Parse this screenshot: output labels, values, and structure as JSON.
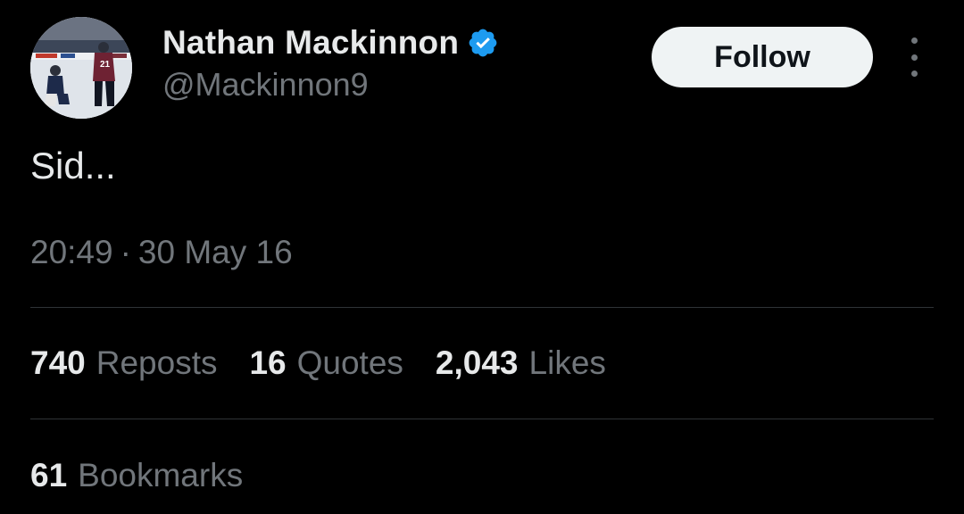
{
  "user": {
    "display_name": "Nathan Mackinnon",
    "handle": "@Mackinnon9",
    "verified": true,
    "avatar_icon": "hockey-players-avatar"
  },
  "actions": {
    "follow_label": "Follow",
    "more_icon": "more-vertical-icon"
  },
  "tweet": {
    "text": "Sid...",
    "time": "20:49",
    "separator": "·",
    "date": "30 May 16"
  },
  "stats": {
    "reposts": {
      "count": "740",
      "label": "Reposts"
    },
    "quotes": {
      "count": "16",
      "label": "Quotes"
    },
    "likes": {
      "count": "2,043",
      "label": "Likes"
    },
    "bookmarks": {
      "count": "61",
      "label": "Bookmarks"
    }
  },
  "colors": {
    "background": "#000000",
    "primary_text": "#e7e9ea",
    "secondary_text": "#71767b",
    "divider": "#2f3336",
    "follow_bg": "#eff3f4",
    "verified_blue": "#1d9bf0"
  }
}
